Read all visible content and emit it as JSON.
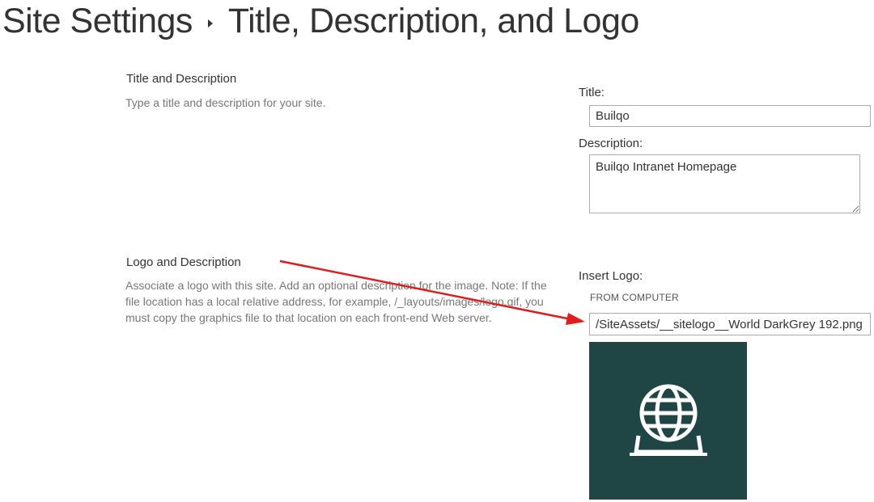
{
  "breadcrumb": {
    "parent": "Site Settings",
    "current": "Title, Description, and Logo"
  },
  "title_section": {
    "heading": "Title and Description",
    "description": "Type a title and description for your site.",
    "title_label": "Title:",
    "title_value": "Builqo",
    "description_label": "Description:",
    "description_value": "Builqo Intranet Homepage"
  },
  "logo_section": {
    "heading": "Logo and Description",
    "description": "Associate a logo with this site. Add an optional description for the image. Note: If the file location has a local relative address, for example, /_layouts/images/logo.gif, you must copy the graphics file to that location on each front-end Web server.",
    "insert_label": "Insert Logo:",
    "source_label": "FROM COMPUTER",
    "logo_url": "/SiteAssets/__sitelogo__World DarkGrey 192.png"
  },
  "logo_preview": {
    "icon": "globe-icon",
    "background_color": "#1f4545",
    "icon_color": "#ffffff"
  },
  "annotation": {
    "color": "#e21b1b"
  }
}
